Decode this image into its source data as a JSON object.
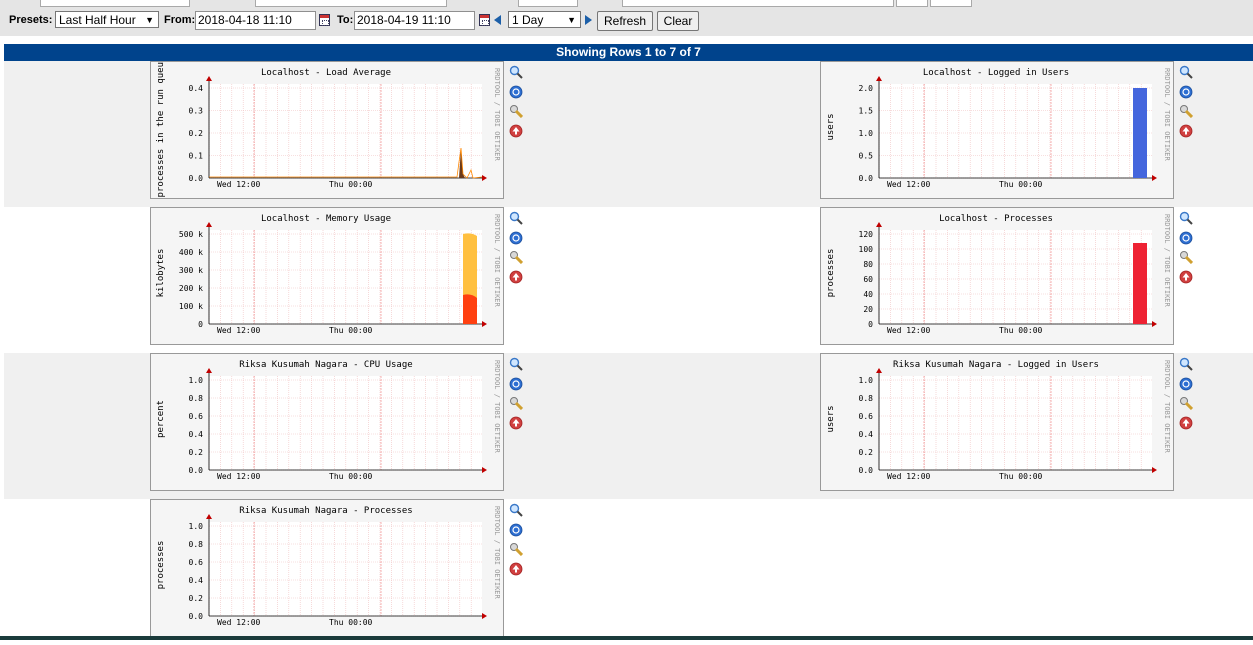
{
  "filters": {
    "presets_label": "Presets:",
    "preset_value": "Last Half Hour",
    "from_label": "From:",
    "from_value": "2018-04-18 11:10",
    "to_label": "To:",
    "to_value": "2018-04-19 11:10",
    "timespan_value": "1 Day",
    "refresh_label": "Refresh",
    "clear_label": "Clear"
  },
  "rows_banner": "Showing Rows 1 to 7 of 7",
  "graph_common": {
    "xticks": [
      "Wed 12:00",
      "Thu 00:00"
    ],
    "watermark": "RRDTOOL / TOBI OETIKER"
  },
  "colors": {
    "banner": "#00438c",
    "row_alt": "#f0f0f0",
    "grid_minor": "#f0c0c0",
    "axis_arrow": "#c00000",
    "series_users": "#4466dd",
    "series_processes": "#ee2233",
    "series_mem_total": "#ffc040",
    "series_mem_used": "#ff4010"
  },
  "graphs": [
    {
      "title": "Localhost - Load Average",
      "ylabel": "processes in the run queue",
      "yticks": [
        "0.4",
        "0.3",
        "0.2",
        "0.1",
        "0.0"
      ]
    },
    {
      "title": "Localhost - Logged in Users",
      "ylabel": "users",
      "yticks": [
        "2.0",
        "1.5",
        "1.0",
        "0.5",
        "0.0"
      ]
    },
    {
      "title": "Localhost - Memory Usage",
      "ylabel": "kilobytes",
      "yticks": [
        "500 k",
        "400 k",
        "300 k",
        "200 k",
        "100 k",
        "0"
      ]
    },
    {
      "title": "Localhost - Processes",
      "ylabel": "processes",
      "yticks": [
        "120",
        "100",
        "80",
        "60",
        "40",
        "20",
        "0"
      ]
    },
    {
      "title": "Riksa Kusumah Nagara - CPU Usage",
      "ylabel": "percent",
      "yticks": [
        "1.0",
        "0.8",
        "0.6",
        "0.4",
        "0.2",
        "0.0"
      ]
    },
    {
      "title": "Riksa Kusumah Nagara - Logged in Users",
      "ylabel": "users",
      "yticks": [
        "1.0",
        "0.8",
        "0.6",
        "0.4",
        "0.2",
        "0.0"
      ]
    },
    {
      "title": "Riksa Kusumah Nagara - Processes",
      "ylabel": "processes",
      "yticks": [
        "1.0",
        "0.8",
        "0.6",
        "0.4",
        "0.2",
        "0.0"
      ]
    }
  ],
  "graph_icons": [
    "zoom-icon",
    "info-icon",
    "edit-icon",
    "remove-icon"
  ]
}
